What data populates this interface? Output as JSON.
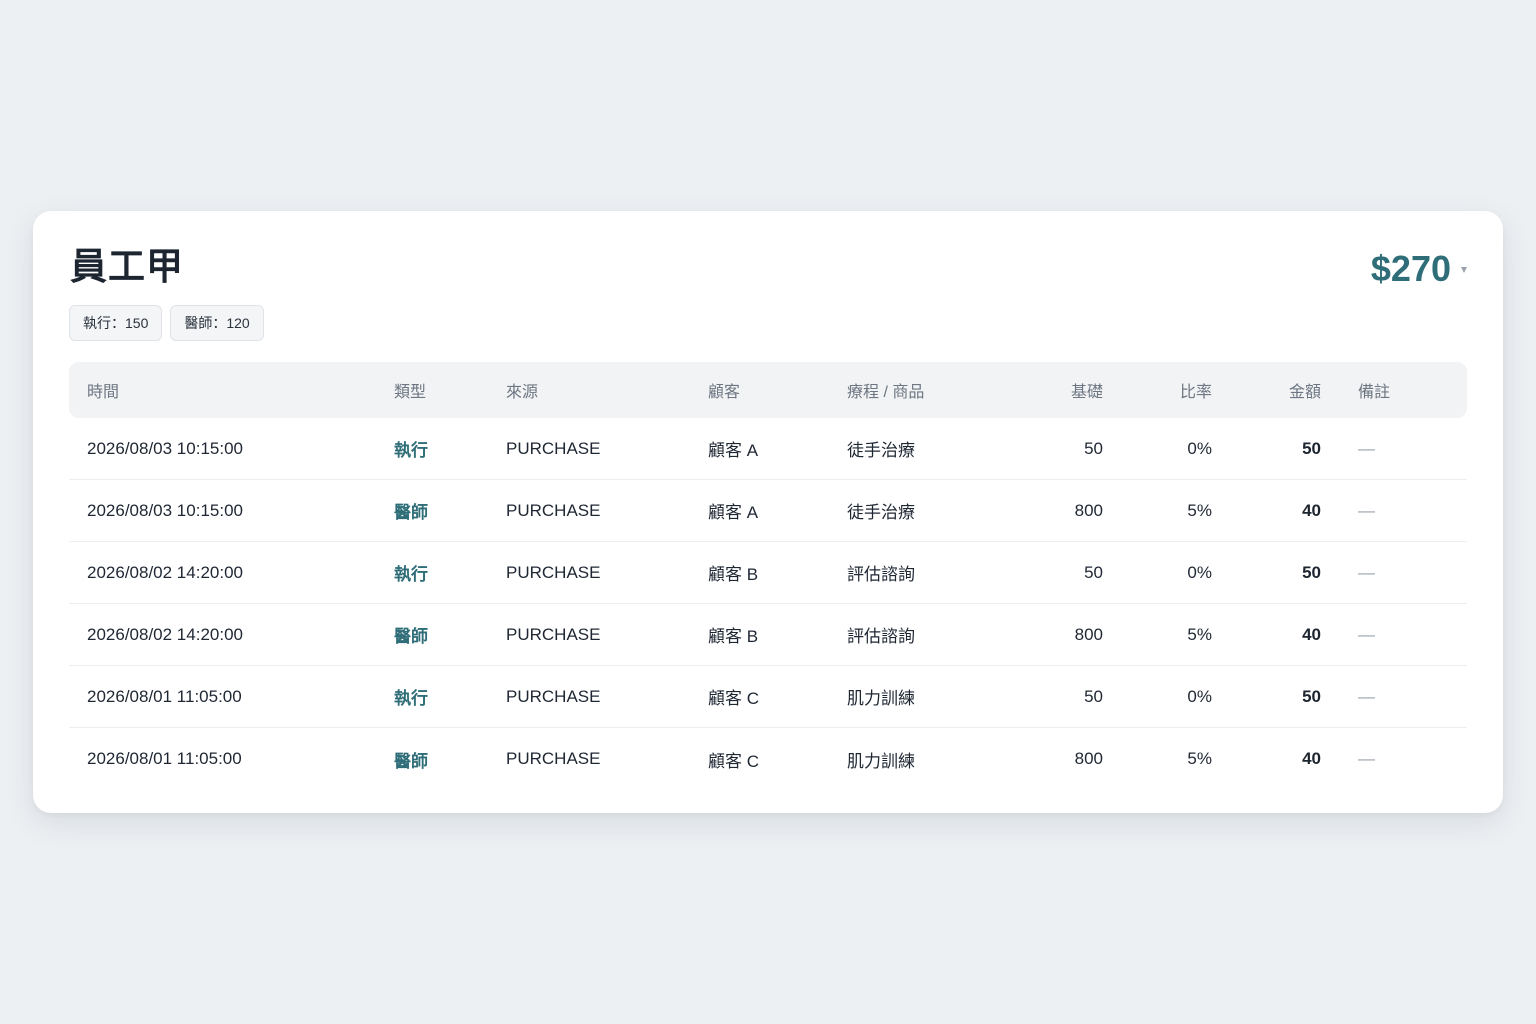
{
  "employee": {
    "name": "員工甲",
    "total": "$270"
  },
  "badges": [
    {
      "label": "執行：150"
    },
    {
      "label": "醫師：120"
    }
  ],
  "table": {
    "headers": {
      "time": "時間",
      "type": "類型",
      "source": "來源",
      "customer": "顧客",
      "item": "療程 / 商品",
      "base": "基礎",
      "rate": "比率",
      "amount": "金額",
      "note": "備註"
    },
    "rows": [
      {
        "time": "2026/08/03 10:15:00",
        "type": "執行",
        "source": "PURCHASE",
        "customer": "顧客 A",
        "item": "徒手治療",
        "base": "50",
        "rate": "0%",
        "amount": "50",
        "note": "—"
      },
      {
        "time": "2026/08/03 10:15:00",
        "type": "醫師",
        "source": "PURCHASE",
        "customer": "顧客 A",
        "item": "徒手治療",
        "base": "800",
        "rate": "5%",
        "amount": "40",
        "note": "—"
      },
      {
        "time": "2026/08/02 14:20:00",
        "type": "執行",
        "source": "PURCHASE",
        "customer": "顧客 B",
        "item": "評估諮詢",
        "base": "50",
        "rate": "0%",
        "amount": "50",
        "note": "—"
      },
      {
        "time": "2026/08/02 14:20:00",
        "type": "醫師",
        "source": "PURCHASE",
        "customer": "顧客 B",
        "item": "評估諮詢",
        "base": "800",
        "rate": "5%",
        "amount": "40",
        "note": "—"
      },
      {
        "time": "2026/08/01 11:05:00",
        "type": "執行",
        "source": "PURCHASE",
        "customer": "顧客 C",
        "item": "肌力訓練",
        "base": "50",
        "rate": "0%",
        "amount": "50",
        "note": "—"
      },
      {
        "time": "2026/08/01 11:05:00",
        "type": "醫師",
        "source": "PURCHASE",
        "customer": "顧客 C",
        "item": "肌力訓練",
        "base": "800",
        "rate": "5%",
        "amount": "40",
        "note": "—"
      }
    ]
  },
  "colors": {
    "accent": "#2f6e78",
    "background": "#edf0f3",
    "header_bg": "#f2f3f5"
  },
  "icons": {
    "expand": "chevron-down-icon"
  }
}
